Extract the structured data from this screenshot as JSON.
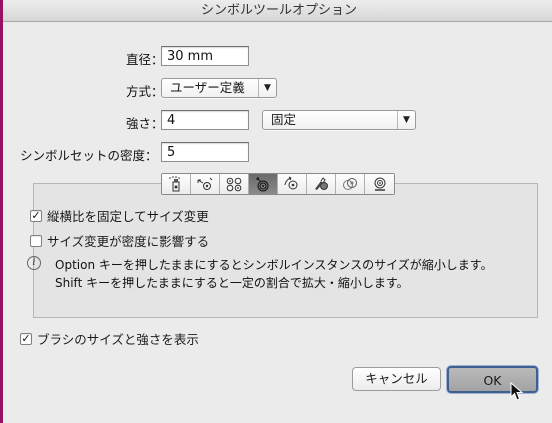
{
  "window": {
    "title": "シンボルツールオプション"
  },
  "diameter": {
    "label": "直径：",
    "value": "30 mm"
  },
  "method": {
    "label": "方式：",
    "selected": "ユーザー定義"
  },
  "intensity": {
    "label": "強さ：",
    "value": "4",
    "mode_selected": "固定"
  },
  "density": {
    "label": "シンボルセットの密度：",
    "value": "5"
  },
  "tools": [
    {
      "name": "symbol-sprayer-tool-icon",
      "active": false
    },
    {
      "name": "symbol-shifter-tool-icon",
      "active": false
    },
    {
      "name": "symbol-scruncher-tool-icon",
      "active": false
    },
    {
      "name": "symbol-sizer-tool-icon",
      "active": true
    },
    {
      "name": "symbol-spinner-tool-icon",
      "active": false
    },
    {
      "name": "symbol-stainer-tool-icon",
      "active": false
    },
    {
      "name": "symbol-screener-tool-icon",
      "active": false
    },
    {
      "name": "symbol-styler-tool-icon",
      "active": false
    }
  ],
  "options": {
    "proportional": {
      "label": "縦横比を固定してサイズ変更",
      "checked": true
    },
    "density_affect": {
      "label": "サイズ変更が密度に影響する",
      "checked": false
    }
  },
  "info": {
    "line1": "Option キーを押したままにするとシンボルインスタンスのサイズが縮小します。",
    "line2": "Shift キーを押したままにすると一定の割合で拡大・縮小します。"
  },
  "show_brush": {
    "label": "ブラシのサイズと強さを表示",
    "checked": true
  },
  "buttons": {
    "cancel": "キャンセル",
    "ok": "OK"
  },
  "colors": {
    "accent_border": "#9a0f64",
    "default_button_border": "#3e5f8f"
  }
}
